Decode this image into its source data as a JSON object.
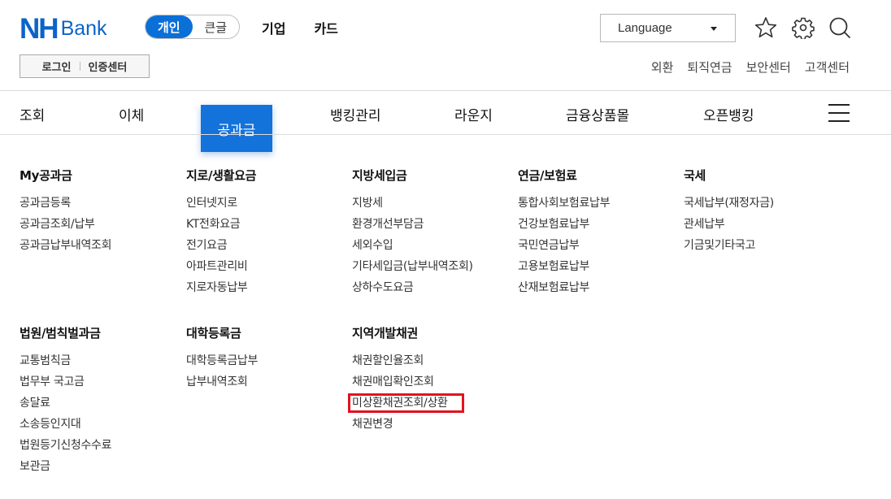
{
  "header": {
    "logo": {
      "brand": "NH",
      "product": "Bank"
    },
    "mode_toggle": [
      {
        "label": "개인",
        "active": true
      },
      {
        "label": "큰글",
        "active": false
      }
    ],
    "top_nav": [
      "기업",
      "카드"
    ],
    "language_select": {
      "value": "Language"
    },
    "icons": [
      "star-icon",
      "gear-icon",
      "search-icon"
    ],
    "login": {
      "login_label": "로그인",
      "cert_label": "인증센터"
    },
    "util_nav": [
      "외환",
      "퇴직연금",
      "보안센터",
      "고객센터"
    ]
  },
  "gnb": {
    "items": [
      "조회",
      "이체",
      "공과금",
      "뱅킹관리",
      "라운지",
      "금융상품몰",
      "오픈뱅킹"
    ],
    "active": "공과금",
    "menu_icon": "hamburger-menu-icon"
  },
  "mega_menu": {
    "row1": [
      {
        "title": "My공과금",
        "links": [
          "공과금등록",
          "공과금조회/납부",
          "공과금납부내역조회"
        ]
      },
      {
        "title": "지로/생활요금",
        "links": [
          "인터넷지로",
          "KT전화요금",
          "전기요금",
          "아파트관리비",
          "지로자동납부"
        ]
      },
      {
        "title": "지방세입금",
        "links": [
          "지방세",
          "환경개선부담금",
          "세외수입",
          "기타세입금(납부내역조회)",
          "상하수도요금"
        ]
      },
      {
        "title": "연금/보험료",
        "links": [
          "통합사회보험료납부",
          "건강보험료납부",
          "국민연금납부",
          "고용보험료납부",
          "산재보험료납부"
        ]
      },
      {
        "title": "국세",
        "links": [
          "국세납부(재정자금)",
          "관세납부",
          "기금및기타국고"
        ]
      }
    ],
    "row2": [
      {
        "title": "법원/범칙벌과금",
        "links": [
          "교통범칙금",
          "법무부 국고금",
          "송달료",
          "소송등인지대",
          "법원등기신청수수료",
          "보관금"
        ]
      },
      {
        "title": "대학등록금",
        "links": [
          "대학등록금납부",
          "납부내역조회"
        ]
      },
      {
        "title": "지역개발채권",
        "links": [
          "채권할인율조회",
          "채권매입확인조회",
          "미상환채권조회/상환",
          "채권변경"
        ]
      }
    ],
    "highlighted_link": "미상환채권조회/상환",
    "highlight_color": "#e3131f"
  },
  "colors": {
    "brand": "#0b64c9",
    "active_tab": "#1472db"
  }
}
